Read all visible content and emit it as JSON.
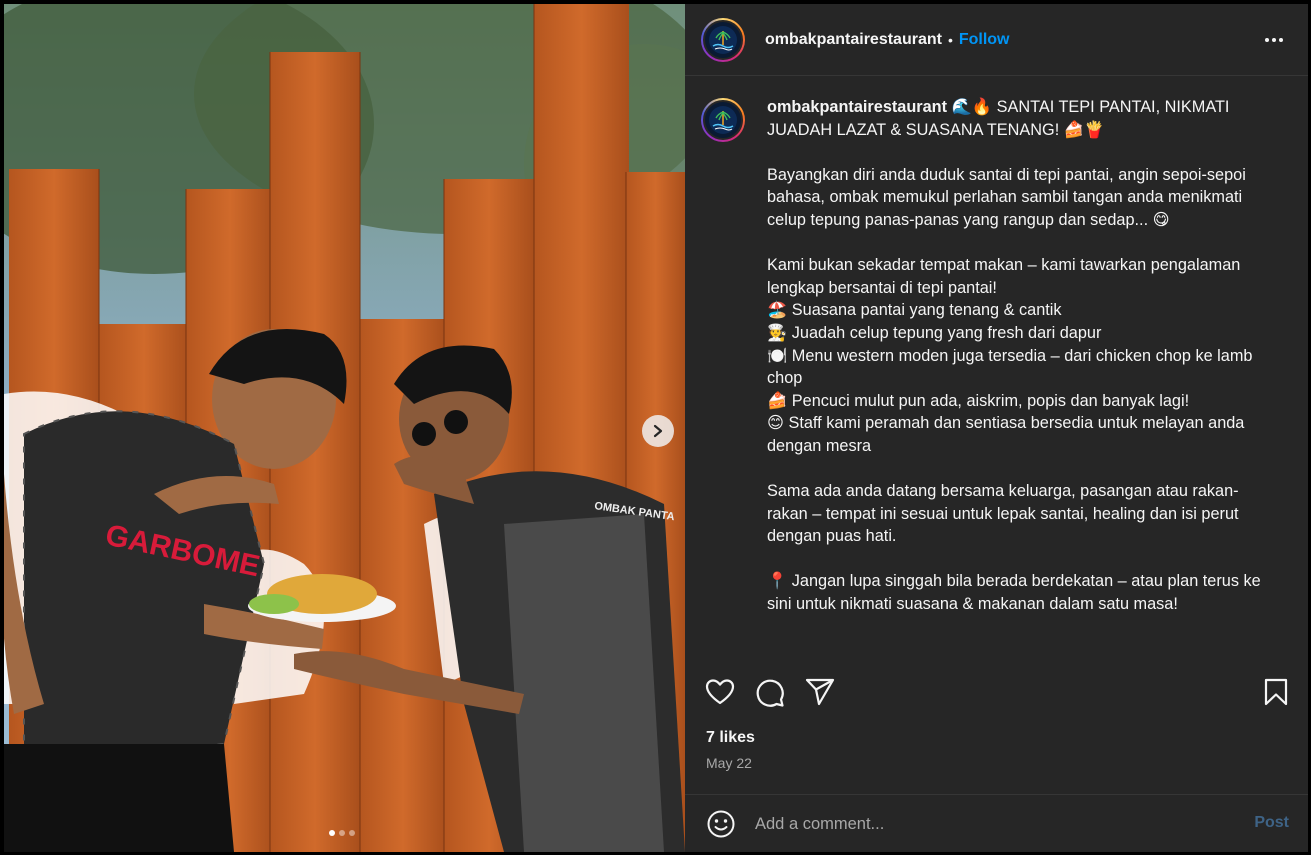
{
  "account": {
    "username": "ombakpantairestaurant",
    "separator": "•",
    "follow_label": "Follow",
    "avatar_icon": "restaurant-logo-icon"
  },
  "caption": {
    "username": "ombakpantairestaurant",
    "paragraphs": [
      "🌊🔥 SANTAI TEPI PANTAI, NIKMATI JUADAH LAZAT & SUASANA TENANG! 🍰🍟",
      "Bayangkan diri anda duduk santai di tepi pantai, angin sepoi-sepoi bahasa, ombak memukul perlahan sambil tangan anda menikmati celup tepung panas-panas yang rangup dan sedap... 😋",
      "Kami bukan sekadar tempat makan – kami tawarkan pengalaman lengkap bersantai di tepi pantai!\n🏖️ Suasana pantai yang tenang & cantik\n🧑‍🍳 Juadah celup tepung yang fresh dari dapur\n🍽️ Menu western moden juga tersedia – dari chicken chop ke lamb chop\n🍰 Pencuci mulut pun ada, aiskrim, popis dan banyak lagi!\n😊 Staff kami peramah dan sentiasa bersedia untuk melayan anda dengan mesra",
      "Sama ada anda datang bersama keluarga, pasangan atau rakan-rakan – tempat ini sesuai untuk lepak santai, healing dan isi perut dengan puas hati.",
      "📍 Jangan lupa singgah bila berada berdekatan – atau plan terus ke sini untuk nikmati suasana & makanan dalam satu masa!"
    ]
  },
  "actions": {
    "like_icon": "heart-icon",
    "comment_icon": "comment-bubble-icon",
    "share_icon": "paper-plane-icon",
    "save_icon": "bookmark-icon"
  },
  "likes_text": "7 likes",
  "date_text": "May 22",
  "comment": {
    "placeholder": "Add a comment...",
    "post_label": "Post"
  },
  "carousel": {
    "slide_count": 3,
    "active_index": 0
  },
  "colors": {
    "follow_blue": "#0095f6",
    "panel_bg": "#262626",
    "post_disabled": "#3e6386"
  }
}
